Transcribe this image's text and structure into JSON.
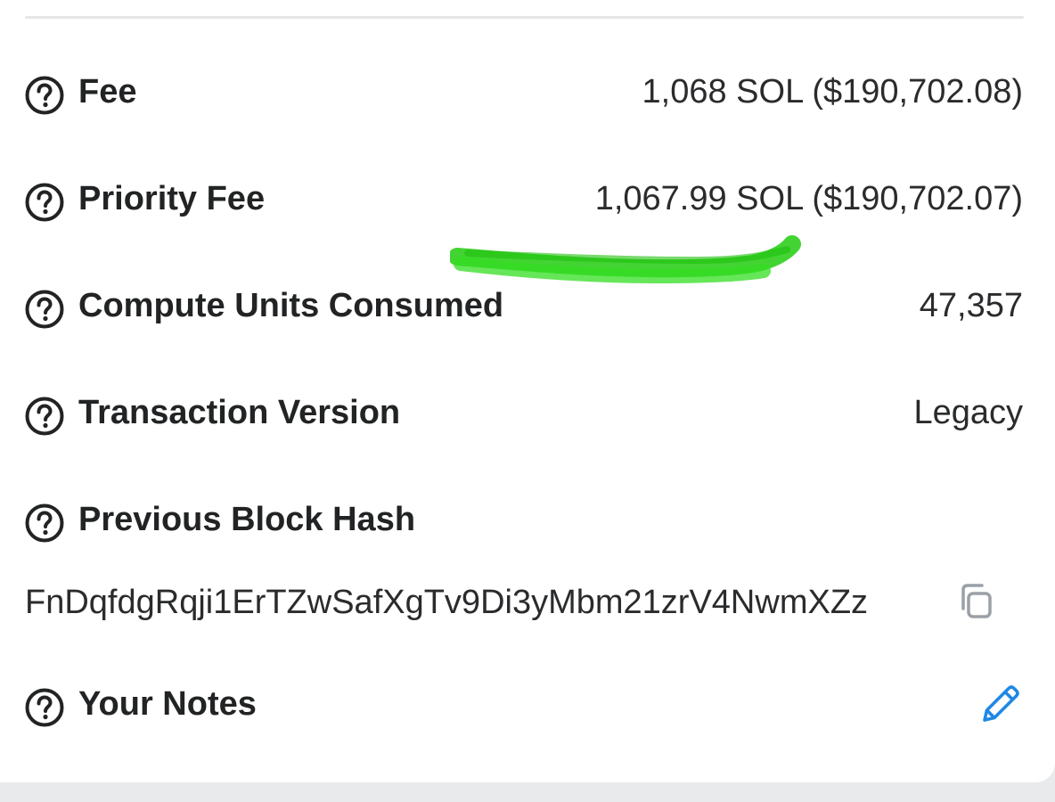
{
  "details": {
    "fee": {
      "label": "Fee",
      "value": "1,068 SOL ($190,702.08)"
    },
    "priority_fee": {
      "label": "Priority Fee",
      "value": "1,067.99 SOL ($190,702.07)"
    },
    "compute_units": {
      "label": "Compute Units Consumed",
      "value": "47,357"
    },
    "transaction_version": {
      "label": "Transaction Version",
      "value": "Legacy"
    },
    "previous_block_hash": {
      "label": "Previous Block Hash",
      "value": "FnDqfdgRqji1ErTZwSafXgTv9Di3yMbm21zrV4NwmXZz"
    },
    "your_notes": {
      "label": "Your Notes"
    }
  },
  "icons": {
    "help": "question-circle-icon",
    "copy": "copy-icon",
    "edit": "pencil-icon"
  },
  "colors": {
    "text_primary": "#222324",
    "icon_gray": "#9aa0a6",
    "edit_blue": "#1e88e5",
    "scribble_green": "#22cc11"
  }
}
